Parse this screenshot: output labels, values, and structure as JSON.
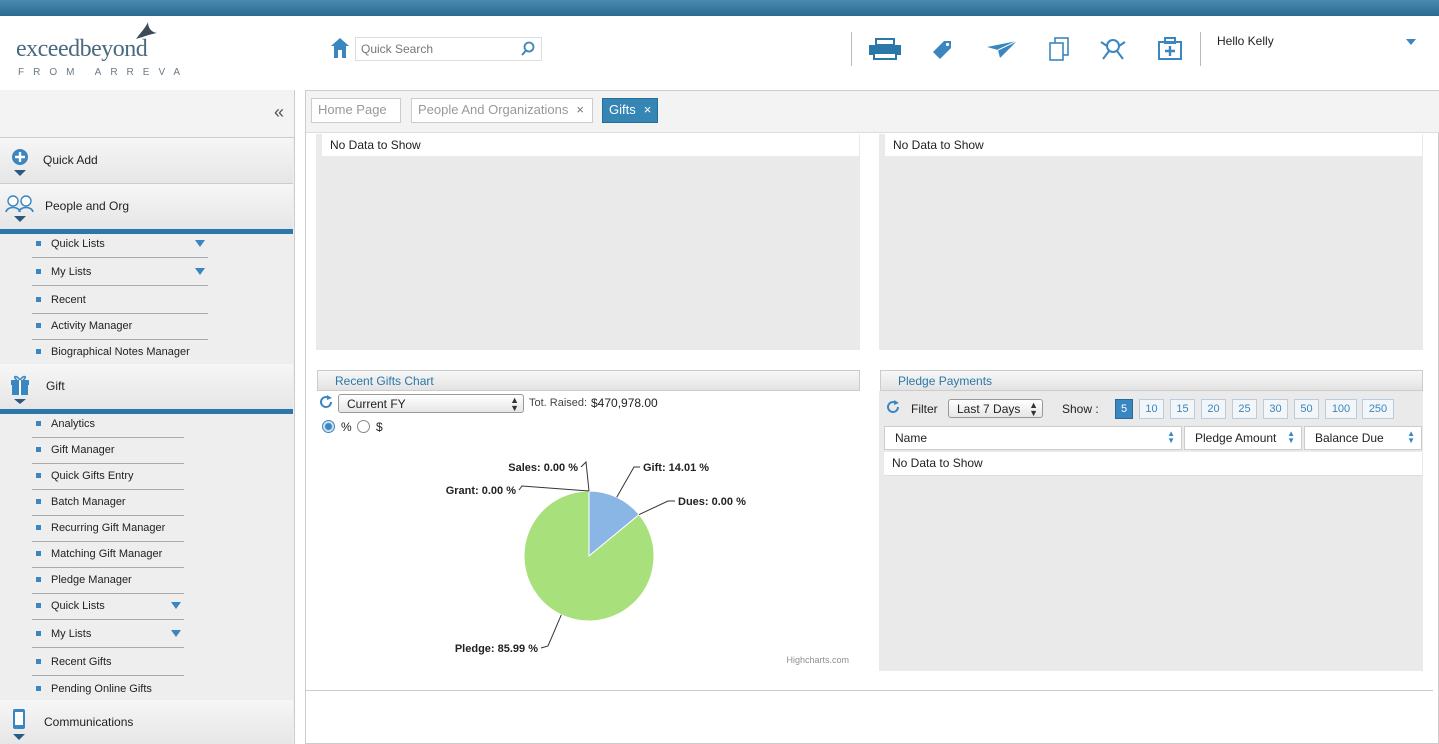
{
  "brand": {
    "name_part1": "exceed",
    "name_part2": "beyond",
    "tagline": "FROM ARREVA"
  },
  "search": {
    "placeholder": "Quick Search"
  },
  "header": {
    "greeting": "Hello Kelly",
    "toolbar_icons": [
      "print-icon",
      "tag-icon",
      "send-icon",
      "copy-icon",
      "event-icon",
      "add-record-icon"
    ]
  },
  "sidebar": {
    "collapse_label": "«",
    "sections": [
      {
        "label": "Quick Add"
      },
      {
        "label": "People and Org"
      },
      {
        "label": "Gift"
      },
      {
        "label": "Communications"
      }
    ],
    "people_items": [
      {
        "label": "Quick Lists"
      },
      {
        "label": "My Lists"
      },
      {
        "label": "Recent"
      },
      {
        "label": "Activity Manager"
      },
      {
        "label": "Biographical Notes Manager"
      }
    ],
    "gift_items": [
      {
        "label": "Analytics"
      },
      {
        "label": "Gift Manager"
      },
      {
        "label": "Quick Gifts Entry"
      },
      {
        "label": "Batch Manager"
      },
      {
        "label": "Recurring Gift Manager"
      },
      {
        "label": "Matching Gift Manager"
      },
      {
        "label": "Pledge Manager"
      },
      {
        "label": "Quick Lists"
      },
      {
        "label": "My Lists"
      },
      {
        "label": "Recent Gifts"
      },
      {
        "label": "Pending Online Gifts"
      }
    ]
  },
  "tabs": [
    {
      "label": "Home Page",
      "closable": false
    },
    {
      "label": "People And Organizations",
      "closable": true,
      "close": "×"
    },
    {
      "label": "Gifts",
      "closable": true,
      "close": "×",
      "active": true
    }
  ],
  "panels": {
    "top_left": {
      "message": "No Data to Show"
    },
    "top_right": {
      "message": "No Data to Show"
    }
  },
  "recent_gifts": {
    "title": "Recent Gifts Chart",
    "period": "Current FY",
    "total_label": "Tot. Raised:",
    "total_value": "$470,978.00",
    "percent_label": "%",
    "dollar_label": "$",
    "selected_mode": "%",
    "credit": "Highcharts.com"
  },
  "chart_data": {
    "type": "pie",
    "slices": [
      {
        "name": "Gift",
        "value": 14.01,
        "label": "Gift: 14.01 %",
        "color": "#8ab6e6"
      },
      {
        "name": "Dues",
        "value": 0.0,
        "label": "Dues: 0.00 %",
        "color": "#7cb5ec"
      },
      {
        "name": "Pledge",
        "value": 85.99,
        "label": "Pledge: 85.99 %",
        "color": "#a8e07c"
      },
      {
        "name": "Grant",
        "value": 0.0,
        "label": "Grant: 0.00 %",
        "color": "#f7a35c"
      },
      {
        "name": "Sales",
        "value": 0.0,
        "label": "Sales: 0.00 %",
        "color": "#8085e9"
      }
    ],
    "credit": "Highcharts.com"
  },
  "pledge_payments": {
    "title": "Pledge Payments",
    "filter_label": "Filter",
    "filter_value": "Last 7 Days",
    "show_label": "Show :",
    "page_sizes": [
      "5",
      "10",
      "15",
      "20",
      "25",
      "30",
      "50",
      "100",
      "250"
    ],
    "selected_page_size": "5",
    "columns": [
      "Name",
      "Pledge Amount",
      "Balance Due"
    ],
    "message": "No Data to Show"
  },
  "colors": {
    "accent": "#3585b5",
    "pie_gift": "#8ab6e6",
    "pie_pledge": "#a8e07c"
  }
}
